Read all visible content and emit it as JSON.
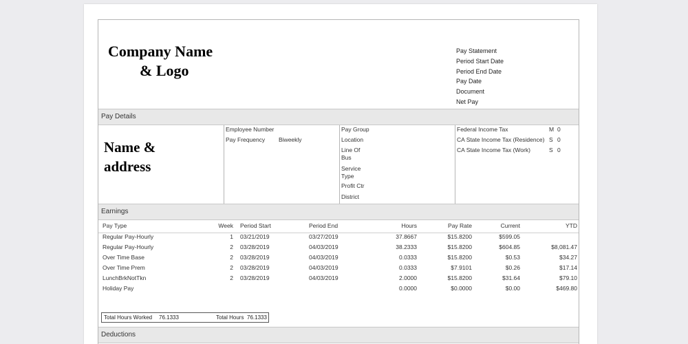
{
  "header": {
    "company_line1": "Company Name",
    "company_line2": "& Logo",
    "labels": [
      "Pay Statement",
      "Period Start Date",
      "Period End Date",
      "Pay Date",
      "Document",
      "Net Pay"
    ]
  },
  "pay_details": {
    "section_title": "Pay Details",
    "name_line1": "Name &",
    "name_line2": "address",
    "employee_number_label": "Employee Number",
    "pay_frequency_label": "Pay Frequency",
    "pay_frequency_value": "Biweekly",
    "pay_group_label": "Pay Group",
    "location_label": "Location",
    "line_of_bus_label": "Line Of\nBus",
    "service_type_label": "Service\nType",
    "profit_ctr_label": "Profit Ctr",
    "district_label": "District",
    "taxes": [
      {
        "label": "Federal Income Tax",
        "code": "M",
        "value": "0"
      },
      {
        "label": "CA State Income Tax (Residence)",
        "code": "S",
        "value": "0"
      },
      {
        "label": "CA  State Income Tax (Work)",
        "code": "S",
        "value": "0"
      }
    ]
  },
  "earnings": {
    "section_title": "Earnings",
    "columns": [
      "Pay Type",
      "Week",
      "Period Start",
      "Period End",
      "Hours",
      "Pay Rate",
      "Current",
      "YTD"
    ],
    "rows": [
      [
        "Regular Pay-Hourly",
        "1",
        "03/21/2019",
        "03/27/2019",
        "37.8667",
        "$15.8200",
        "$599.05",
        ""
      ],
      [
        "Regular Pay-Hourly",
        "2",
        "03/28/2019",
        "04/03/2019",
        "38.2333",
        "$15.8200",
        "$604.85",
        "$8,081.47"
      ],
      [
        "Over Time Base",
        "2",
        "03/28/2019",
        "04/03/2019",
        "0.0333",
        "$15.8200",
        "$0.53",
        "$34.27"
      ],
      [
        "Over Time Prem",
        "2",
        "03/28/2019",
        "04/03/2019",
        "0.0333",
        "$7.9101",
        "$0.26",
        "$17.14"
      ],
      [
        "LunchBrkNotTkn",
        "2",
        "03/28/2019",
        "04/03/2019",
        "2.0000",
        "$15.8200",
        "$31.64",
        "$79.10"
      ],
      [
        "Holiday Pay",
        "",
        "",
        "",
        "0.0000",
        "$0.0000",
        "$0.00",
        "$469.80"
      ]
    ],
    "total_hours_worked_label": "Total Hours Worked",
    "total_hours_worked_value": "76.1333",
    "total_hours_label": "Total Hours",
    "total_hours_value": "76.1333"
  },
  "deductions": {
    "section_title": "Deductions"
  }
}
